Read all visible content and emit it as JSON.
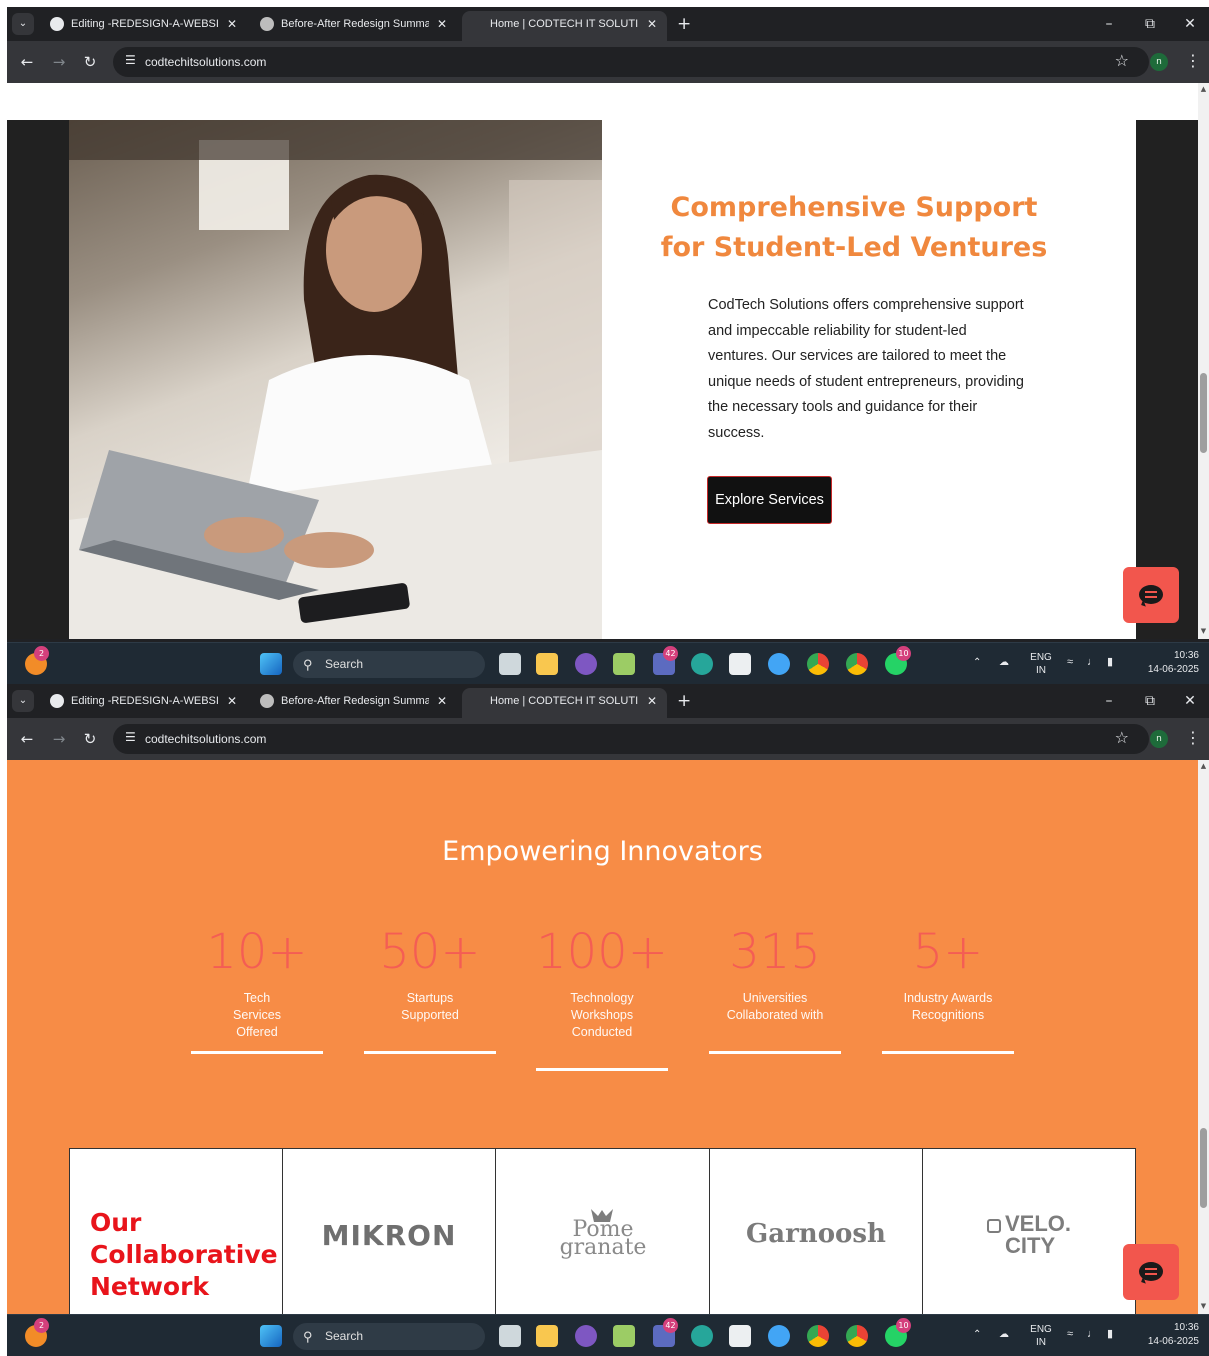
{
  "browser": {
    "tabs": [
      {
        "title": "Editing -REDESIGN-A-WEBSITE",
        "active": false
      },
      {
        "title": "Before-After Redesign Summar",
        "active": false
      },
      {
        "title": "Home | CODTECH IT SOLUTION",
        "active": true
      }
    ],
    "url": "codtechitsolutions.com",
    "profile_initial": "n"
  },
  "hero": {
    "title_line1": "Comprehensive Support",
    "title_line2": "for Student-Led Ventures",
    "body": "CodTech Solutions offers comprehensive support and impeccable reliability for student-led ventures. Our services are tailored to meet the unique needs of student entrepreneurs, providing the necessary tools and guidance for their success.",
    "cta": "Explore Services"
  },
  "stats_section": {
    "title": "Empowering Innovators",
    "stats": [
      {
        "number": "10+",
        "label": "Tech Services Offered"
      },
      {
        "number": "50+",
        "label": "Startups Supported"
      },
      {
        "number": "100+",
        "label": "Technology Workshops Conducted"
      },
      {
        "number": "315",
        "label": "Universities Collaborated with"
      },
      {
        "number": "5+",
        "label": "Industry Awards Recognitions"
      }
    ]
  },
  "partners": {
    "heading": "Our Collaborative Network",
    "logos": [
      "MIKRON",
      "Pome granate",
      "Garnoosh",
      "VELO. CITY"
    ]
  },
  "taskbar": {
    "search_label": "Search",
    "badges": {
      "copilot": "2",
      "teams": "42",
      "whatsapp": "10"
    },
    "lang_line1": "ENG",
    "lang_line2": "IN",
    "time": "10:36",
    "date": "14-06-2025"
  },
  "colors": {
    "accent_orange": "#f0883e",
    "stats_bg": "#f78c46",
    "stat_number": "#f45d54",
    "partner_heading": "#e8141b",
    "chat_button": "#f2564d"
  }
}
